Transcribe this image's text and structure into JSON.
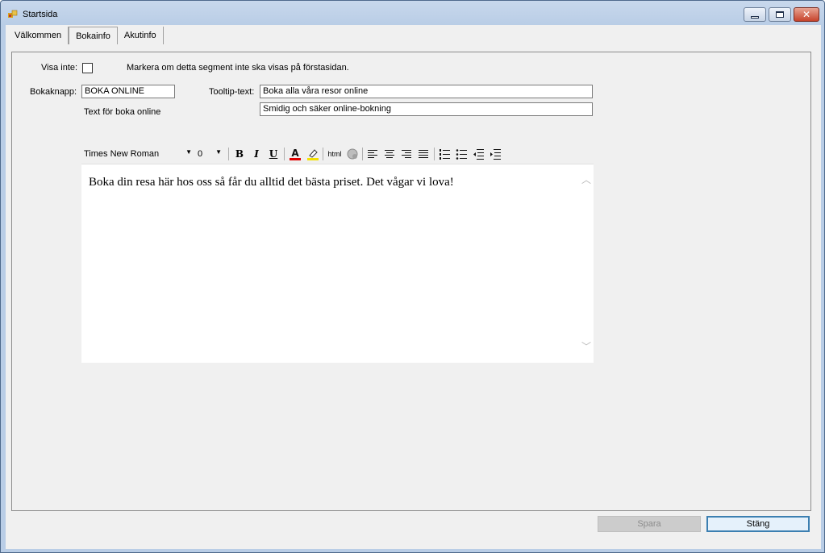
{
  "window": {
    "title": "Startsida"
  },
  "tabs": [
    {
      "label": "Välkommen"
    },
    {
      "label": "Bokainfo",
      "active": true
    },
    {
      "label": "Akutinfo"
    }
  ],
  "form": {
    "visa_inte_label": "Visa inte:",
    "visa_inte_checked": false,
    "visa_inte_hint": "Markera om detta segment inte ska visas på förstasidan.",
    "bokaknapp_label": "Bokaknapp:",
    "bokaknapp_value": "BOKA ONLINE",
    "tooltip_label": "Tooltip-text:",
    "tooltip_value": "Boka alla våra resor online",
    "text_label": "Text för boka online",
    "text_value": "Smidig och säker online-bokning"
  },
  "toolbar": {
    "font": "Times New Roman",
    "size": "0",
    "bold": "B",
    "italic": "I",
    "underline": "U",
    "font_color": "A",
    "html": "html"
  },
  "editor": {
    "content": "Boka din resa här hos oss så får du alltid det bästa priset. Det vågar vi lova!"
  },
  "buttons": {
    "save": "Spara",
    "close": "Stäng"
  }
}
